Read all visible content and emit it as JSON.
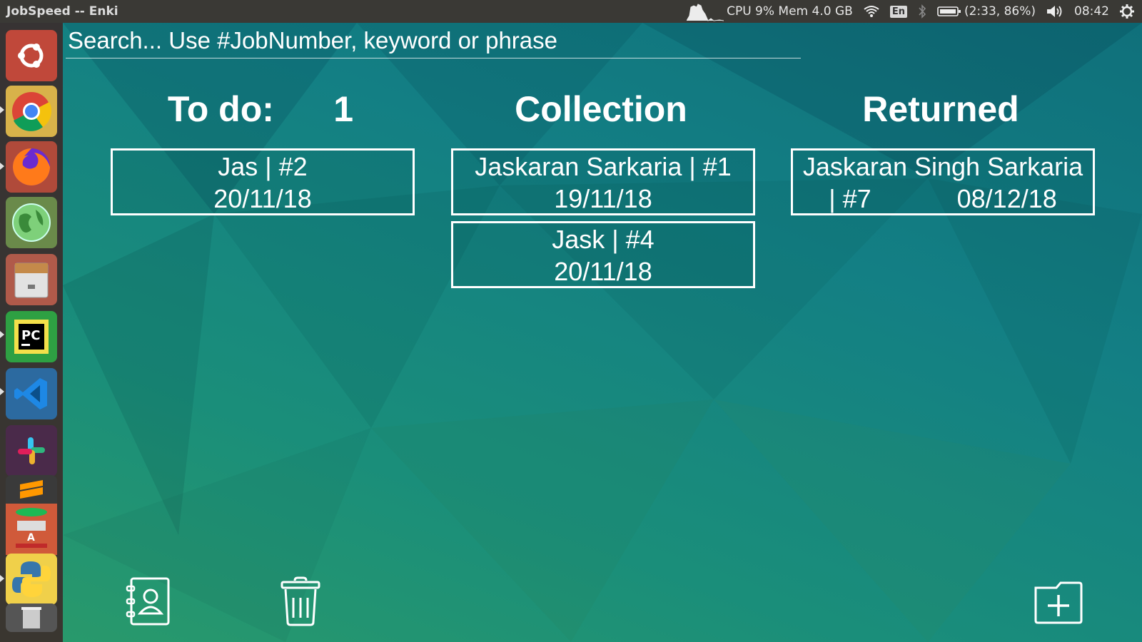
{
  "window_title": "JobSpeed -- Enki",
  "tray": {
    "system_monitor": "CPU 9% Mem 4.0 GB",
    "keyboard_layout": "En",
    "battery": "(2:33, 86%)",
    "clock": "08:42"
  },
  "search": {
    "placeholder": "Search... Use #JobNumber, keyword or phrase"
  },
  "columns": {
    "todo": {
      "title": "To do:      1"
    },
    "collection": {
      "title": "Collection"
    },
    "returned": {
      "title": "Returned"
    }
  },
  "cards": {
    "todo_0": {
      "line1": "Jas | #2",
      "line2": "20/11/18"
    },
    "collection_0": {
      "line1": "Jaskaran Sarkaria | #1",
      "line2": "19/11/18"
    },
    "collection_1": {
      "line1": "Jask | #4",
      "line2": "20/11/18"
    },
    "returned_0": {
      "line1": "Jaskaran Singh Sarkaria",
      "line2": "| #7            08/12/18"
    }
  },
  "launcher_icons": [
    "ubuntu-dash-icon",
    "chrome-icon",
    "firefox-icon",
    "globe-browser-icon",
    "file-cabinet-icon",
    "pycharm-icon",
    "vscode-icon",
    "slack-icon",
    "sublime-text-icon",
    "python-icon",
    "trash-launcher-icon"
  ],
  "colors": {
    "text": "#ffffff",
    "panel": "#3a3935",
    "accent_teal": "#137f84"
  }
}
